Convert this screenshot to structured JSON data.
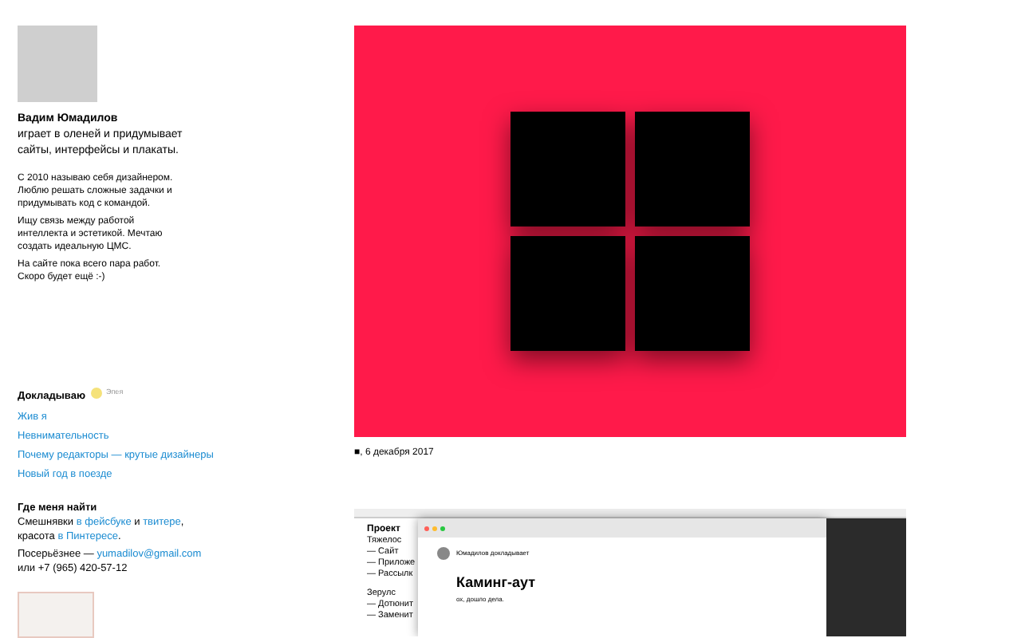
{
  "profile": {
    "name": "Вадим Юмадилов",
    "tagline": "играет в оленей и придумывает сайты, интерфейсы и плакаты.",
    "paragraphs": [
      "С 2010 называю себя дизайнером. Люблю решать сложные задачки и придумывать код с командой.",
      "Ищу связь между работой интеллекта и эстетикой. Мечтаю создать идеальную ЦМС.",
      "На сайте пока всего пара работ. Скоро будет ещё :-)"
    ]
  },
  "talks": {
    "title": "Докладываю",
    "badge": "Эпея",
    "links": [
      "Жив я",
      "Невнимательность",
      "Почему редакторы — крутые дизайнеры",
      "Новый год в поезде"
    ]
  },
  "contacts": {
    "title": "Где меня найти",
    "line_1": [
      "Смешнявки ",
      "в фейсбуке",
      " и ",
      "твитере",
      ","
    ],
    "line_2": [
      "красота ",
      "в Пинтересе",
      "."
    ],
    "line_3": [
      "Посерьёзнее — ",
      "yumadilov@gmail.com"
    ],
    "phone": "или +7 (965) 420-57-12"
  },
  "post": {
    "marker": "■",
    "date": ", 6 декабря 2017"
  },
  "project_shot": {
    "heading": "Проект",
    "lines": [
      "Тяжелос",
      "— Сайт",
      "— Приложе",
      "— Рассылк",
      "Зерулс",
      "— Дотюнит",
      "— Заменит"
    ],
    "window_author": "Юмадилов докладывает",
    "window_title": "Каминг-аут",
    "window_subtitle": "ох, дошло дела."
  }
}
